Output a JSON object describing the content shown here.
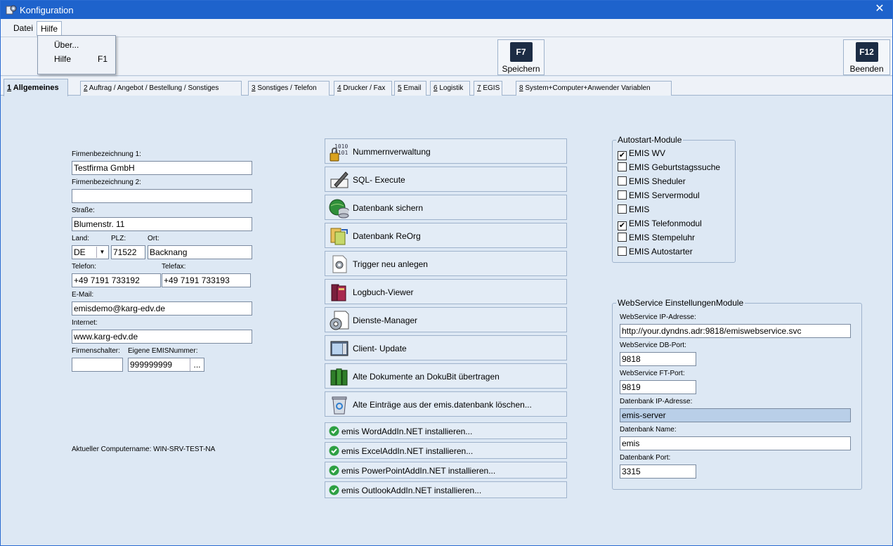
{
  "window": {
    "title": "Konfiguration"
  },
  "menu": {
    "items": [
      "Datei",
      "Hilfe"
    ],
    "dropdown": [
      {
        "label": "Über...",
        "shortcut": ""
      },
      {
        "label": "Hilfe",
        "shortcut": "F1"
      }
    ]
  },
  "toolbar": {
    "save": {
      "key": "F7",
      "label": "Speichern"
    },
    "exit": {
      "key": "F12",
      "label": "Beenden"
    }
  },
  "tabs": [
    {
      "num": "1",
      "label": " Allgemeines"
    },
    {
      "num": "2",
      "label": " Auftrag / Angebot / Bestellung / Sonstiges"
    },
    {
      "num": "3",
      "label": " Sonstiges / Telefon"
    },
    {
      "num": "4",
      "label": " Drucker / Fax"
    },
    {
      "num": "5",
      "label": " Email"
    },
    {
      "num": "6",
      "label": " Logistik"
    },
    {
      "num": "7",
      "label": " EGIS"
    },
    {
      "num": "8",
      "label": " System+Computer+Anwender Variablen"
    }
  ],
  "company": {
    "name1_label": "Firmenbezeichnung 1:",
    "name1": "Testfirma GmbH",
    "name2_label": "Firmenbezeichnung 2:",
    "name2": "",
    "street_label": "Straße:",
    "street": "Blumenstr. 11",
    "country_label": "Land:",
    "country": "DE",
    "zip_label": "PLZ:",
    "zip": "71522",
    "city_label": "Ort:",
    "city": "Backnang",
    "phone_label": "Telefon:",
    "phone": "+49 7191 733192",
    "fax_label": "Telefax:",
    "fax": "+49 7191 733193",
    "email_label": "E-Mail:",
    "email": "emisdemo@karg-edv.de",
    "web_label": "Internet:",
    "web": "www.karg-edv.de",
    "counter_label": "Firmenschalter:",
    "counter": "",
    "emisnr_label": "Eigene EMISNummer:",
    "emisnr": "999999999",
    "browse": "...",
    "computer_name": "Aktueller Computername: WIN-SRV-TEST-NA"
  },
  "actions": [
    {
      "label": "Nummernverwaltung",
      "icon": "number-lock-icon"
    },
    {
      "label": "SQL- Execute",
      "icon": "sql-pen-icon"
    },
    {
      "label": "Datenbank sichern",
      "icon": "database-globe-icon"
    },
    {
      "label": "Datenbank ReOrg",
      "icon": "database-reorg-icon"
    },
    {
      "label": "Trigger neu anlegen",
      "icon": "trigger-gear-icon"
    },
    {
      "label": "Logbuch-Viewer",
      "icon": "logbook-icon"
    },
    {
      "label": "Dienste-Manager",
      "icon": "service-gear-icon"
    },
    {
      "label": "Client- Update",
      "icon": "client-update-icon"
    },
    {
      "label": "Alte Dokumente an DokuBit übertragen",
      "icon": "binders-icon"
    },
    {
      "label": "Alte Einträge aus der emis.datenbank löschen...",
      "icon": "recycle-bin-icon"
    }
  ],
  "addins": [
    "emis WordAddIn.NET installieren...",
    "emis ExcelAddIn.NET installieren...",
    "emis PowerPointAddIn.NET installieren...",
    "emis OutlookAddIn.NET installieren..."
  ],
  "autostart": {
    "title": "Autostart-Module",
    "items": [
      {
        "label": "EMIS WV",
        "checked": true
      },
      {
        "label": "EMIS Geburtstagssuche",
        "checked": false
      },
      {
        "label": "EMIS Sheduler",
        "checked": false
      },
      {
        "label": "EMIS Servermodul",
        "checked": false
      },
      {
        "label": "EMIS",
        "checked": false
      },
      {
        "label": "EMIS Telefonmodul",
        "checked": true
      },
      {
        "label": "EMIS Stempeluhr",
        "checked": false
      },
      {
        "label": "EMIS Autostarter",
        "checked": false
      }
    ]
  },
  "webservice": {
    "title": "WebService EinstellungenModule",
    "ip_label": "WebService IP-Adresse:",
    "ip": "http://your.dyndns.adr:9818/emiswebservice.svc",
    "dbport_label": "WebService DB-Port:",
    "dbport": "9818",
    "ftport_label": "WebService FT-Port:",
    "ftport": "9819",
    "dbip_label": "Datenbank IP-Adresse:",
    "dbip": "emis-server",
    "dbname_label": "Datenbank Name:",
    "dbname": "emis",
    "port_label": "Datenbank Port:",
    "port": "3315"
  }
}
